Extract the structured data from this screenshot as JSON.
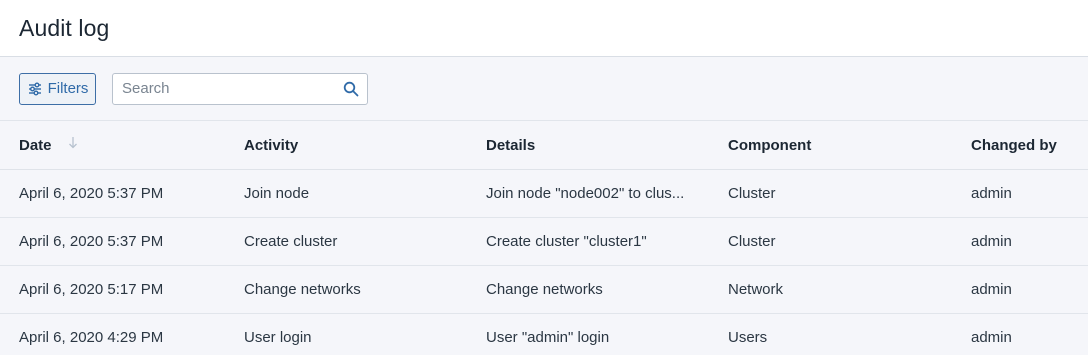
{
  "header": {
    "title": "Audit log"
  },
  "toolbar": {
    "filters_label": "Filters",
    "search_placeholder": "Search",
    "search_value": ""
  },
  "colors": {
    "accent": "#2f6aa8",
    "border": "#d9dee5",
    "background": "#f5f6fa"
  },
  "table": {
    "columns": [
      "Date",
      "Activity",
      "Details",
      "Component",
      "Changed by"
    ],
    "sort": {
      "column": "Date",
      "direction": "descending",
      "icon": "arrow-down-icon"
    },
    "rows": [
      {
        "date": "April 6, 2020 5:37 PM",
        "activity": "Join node",
        "details": "Join node \"node002\" to clus...",
        "component": "Cluster",
        "changed_by": "admin"
      },
      {
        "date": "April 6, 2020 5:37 PM",
        "activity": "Create cluster",
        "details": "Create cluster \"cluster1\"",
        "component": "Cluster",
        "changed_by": "admin"
      },
      {
        "date": "April 6, 2020 5:17 PM",
        "activity": "Change networks",
        "details": "Change networks",
        "component": "Network",
        "changed_by": "admin"
      },
      {
        "date": "April 6, 2020 4:29 PM",
        "activity": "User login",
        "details": "User \"admin\" login",
        "component": "Users",
        "changed_by": "admin"
      }
    ]
  }
}
